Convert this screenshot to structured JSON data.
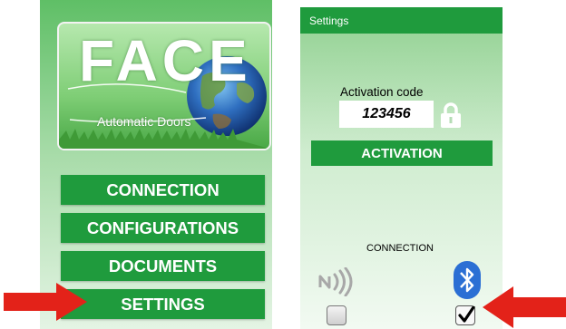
{
  "main_menu": {
    "logo_title": "FACE",
    "logo_subtitle": "Automatic Doors",
    "buttons": [
      {
        "label": "CONNECTION"
      },
      {
        "label": "CONFIGURATIONS"
      },
      {
        "label": "DOCUMENTS"
      },
      {
        "label": "SETTINGS"
      }
    ]
  },
  "settings": {
    "title": "Settings",
    "activation_code_label": "Activation code",
    "activation_code_value": "123456",
    "activation_button": "ACTIVATION",
    "connection_label": "CONNECTION",
    "nfc_checked": false,
    "bluetooth_checked": true
  },
  "colors": {
    "button_green": "#1f9b3d",
    "arrow_red": "#e32219",
    "bluetooth_blue": "#2b6fd4"
  }
}
